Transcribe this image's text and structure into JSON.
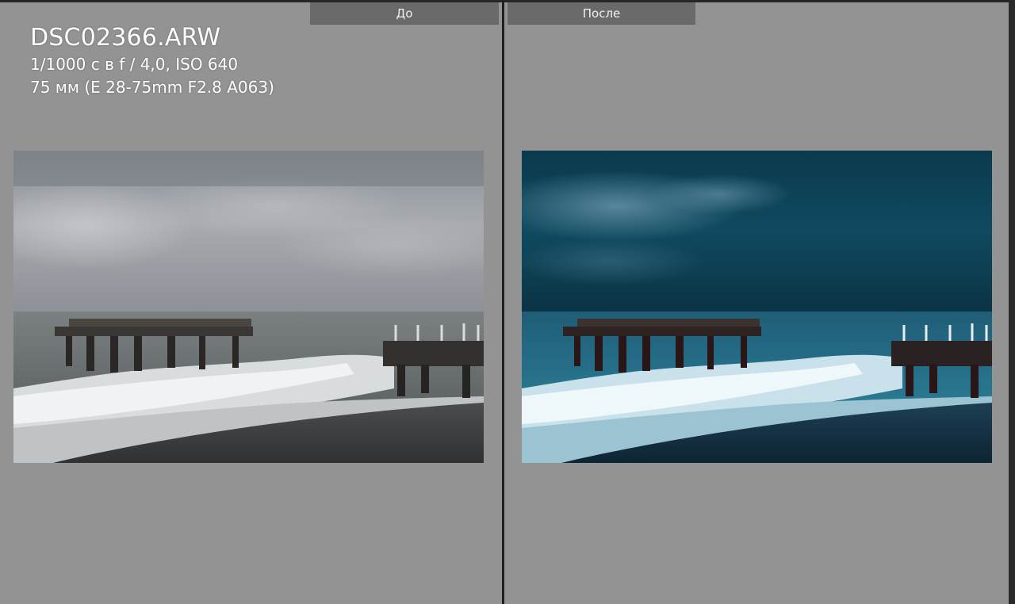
{
  "file_info": {
    "filename": "DSC02366.ARW",
    "exposure": "1/1000 с в f / 4,0, ISO 640",
    "lens": "75 мм (E 28-75mm F2.8 A063)"
  },
  "compare": {
    "before_label": "До",
    "after_label": "После"
  },
  "colors": {
    "panel_bg": "#939393",
    "tab_bg": "#6a6a6a",
    "divider": "#1f1f1f"
  }
}
